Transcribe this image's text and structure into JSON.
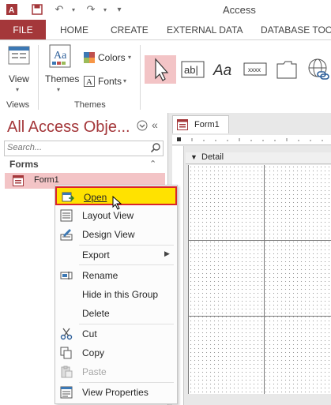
{
  "app": {
    "title": "Access"
  },
  "ribbon": {
    "tabs": [
      "FILE",
      "HOME",
      "CREATE",
      "EXTERNAL DATA",
      "DATABASE TOOL"
    ],
    "active_tab": "FILE",
    "groups": [
      {
        "label": "Views",
        "buttons": [
          "View"
        ]
      },
      {
        "label": "Themes",
        "buttons": [
          "Themes",
          "Colors",
          "Fonts"
        ]
      }
    ],
    "controls_icons": [
      "select-pointer-icon",
      "textbox-icon",
      "label-icon",
      "button-icon",
      "tab-control-icon",
      "hyperlink-icon"
    ]
  },
  "nav": {
    "title": "All Access Obje...",
    "search_placeholder": "Search...",
    "group_label": "Forms",
    "item_label": "Form1"
  },
  "document": {
    "tab_label": "Form1",
    "section_label": "Detail"
  },
  "context_menu": {
    "items": [
      {
        "label": "Open",
        "icon": "open-form-icon",
        "highlighted": true
      },
      {
        "label": "Layout View",
        "icon": "layout-view-icon"
      },
      {
        "label": "Design View",
        "icon": "design-view-icon"
      },
      {
        "label": "Export",
        "icon": "",
        "submenu": true
      },
      {
        "label": "Rename",
        "icon": "rename-icon"
      },
      {
        "label": "Hide in this Group",
        "icon": ""
      },
      {
        "label": "Delete",
        "icon": ""
      },
      {
        "label": "Cut",
        "icon": "scissors-icon"
      },
      {
        "label": "Copy",
        "icon": "copy-icon"
      },
      {
        "label": "Paste",
        "icon": "paste-icon",
        "disabled": true
      },
      {
        "label": "View Properties",
        "icon": "properties-icon"
      }
    ]
  },
  "colors": {
    "accent": "#a4373a",
    "nav_selected": "#f3c4c6",
    "menu_highlight": "#ffe200",
    "highlight_border": "#d9262b"
  }
}
